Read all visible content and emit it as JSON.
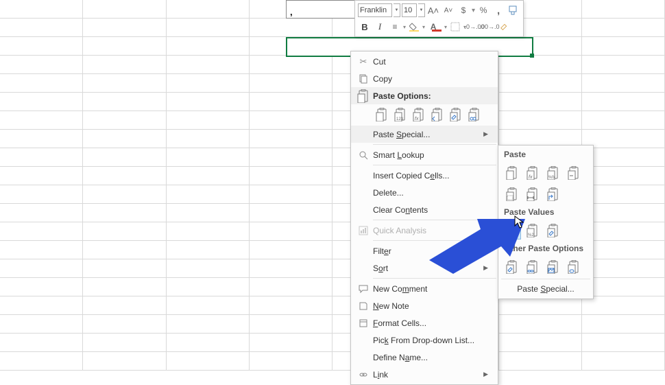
{
  "cellValue": ",",
  "toolbar": {
    "fontName": "Franklin",
    "fontSize": "10",
    "increaseFont": "A▴",
    "decreaseFont": "A▾",
    "accounting": "$",
    "percent": "%",
    "comma": ",",
    "bold": "B",
    "italic": "I"
  },
  "contextMenu": {
    "cut": "Cut",
    "copy": "Copy",
    "pasteOptions": "Paste Options:",
    "pasteSpecial": "Paste Special...",
    "smartLookup": "Smart Lookup",
    "insertCopied": "Insert Copied Cells...",
    "delete": "Delete...",
    "clearContents": "Clear Contents",
    "quickAnalysis": "Quick Analysis",
    "filter": "Filter",
    "sort": "Sort",
    "newComment": "New Comment",
    "newNote": "New Note",
    "formatCells": "Format Cells...",
    "pickFromList": "Pick From Drop-down List...",
    "defineName": "Define Name...",
    "link": "Link"
  },
  "submenu": {
    "paste": "Paste",
    "pasteValues": "Paste Values",
    "otherOptions": "Other Paste Options",
    "pasteSpecial": "Paste Special..."
  }
}
